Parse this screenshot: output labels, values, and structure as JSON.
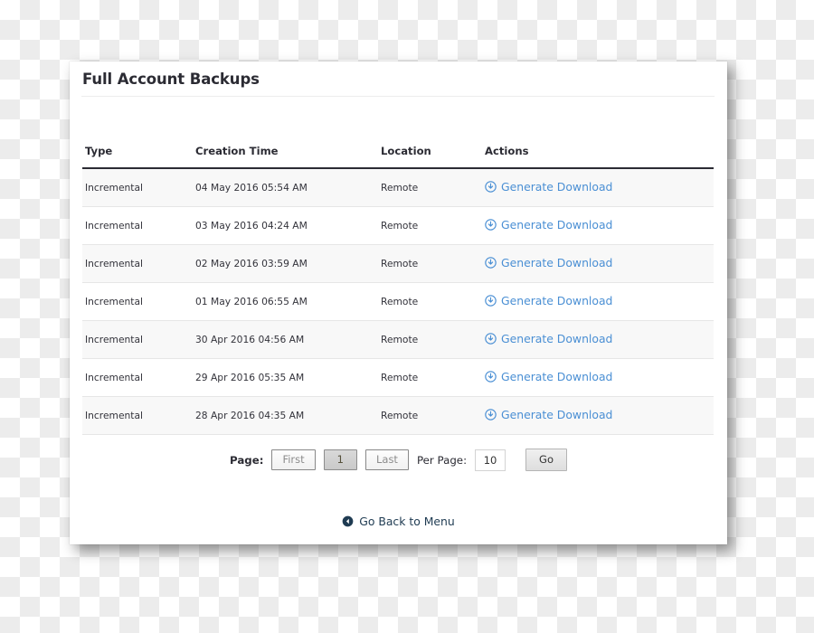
{
  "card": {
    "title": "Full Account Backups"
  },
  "table": {
    "columns": [
      "Type",
      "Creation Time",
      "Location",
      "Actions"
    ],
    "rows": [
      {
        "type": "Incremental",
        "creation_time": "04 May 2016 05:54 AM",
        "location": "Remote",
        "action_label": "Generate Download",
        "action_icon": "download-circle-icon"
      },
      {
        "type": "Incremental",
        "creation_time": "03 May 2016 04:24 AM",
        "location": "Remote",
        "action_label": "Generate Download",
        "action_icon": "download-circle-icon"
      },
      {
        "type": "Incremental",
        "creation_time": "02 May 2016 03:59 AM",
        "location": "Remote",
        "action_label": "Generate Download",
        "action_icon": "download-circle-icon"
      },
      {
        "type": "Incremental",
        "creation_time": "01 May 2016 06:55 AM",
        "location": "Remote",
        "action_label": "Generate Download",
        "action_icon": "download-circle-icon"
      },
      {
        "type": "Incremental",
        "creation_time": "30 Apr 2016 04:56 AM",
        "location": "Remote",
        "action_label": "Generate Download",
        "action_icon": "download-circle-icon"
      },
      {
        "type": "Incremental",
        "creation_time": "29 Apr 2016 05:35 AM",
        "location": "Remote",
        "action_label": "Generate Download",
        "action_icon": "download-circle-icon"
      },
      {
        "type": "Incremental",
        "creation_time": "28 Apr 2016 04:35 AM",
        "location": "Remote",
        "action_label": "Generate Download",
        "action_icon": "download-circle-icon"
      }
    ]
  },
  "pagination": {
    "page_label": "Page:",
    "first_label": "First",
    "current_page": "1",
    "last_label": "Last",
    "per_page_label": "Per Page:",
    "per_page_value": "10",
    "go_label": "Go"
  },
  "footer": {
    "back_label": "Go Back to Menu",
    "back_icon": "arrow-left-circle-icon"
  },
  "colors": {
    "link_blue": "#4a8fd4",
    "back_link_navy": "#1f3b52",
    "header_text": "#2b2b33",
    "row_alt": "#f8f8f8"
  }
}
